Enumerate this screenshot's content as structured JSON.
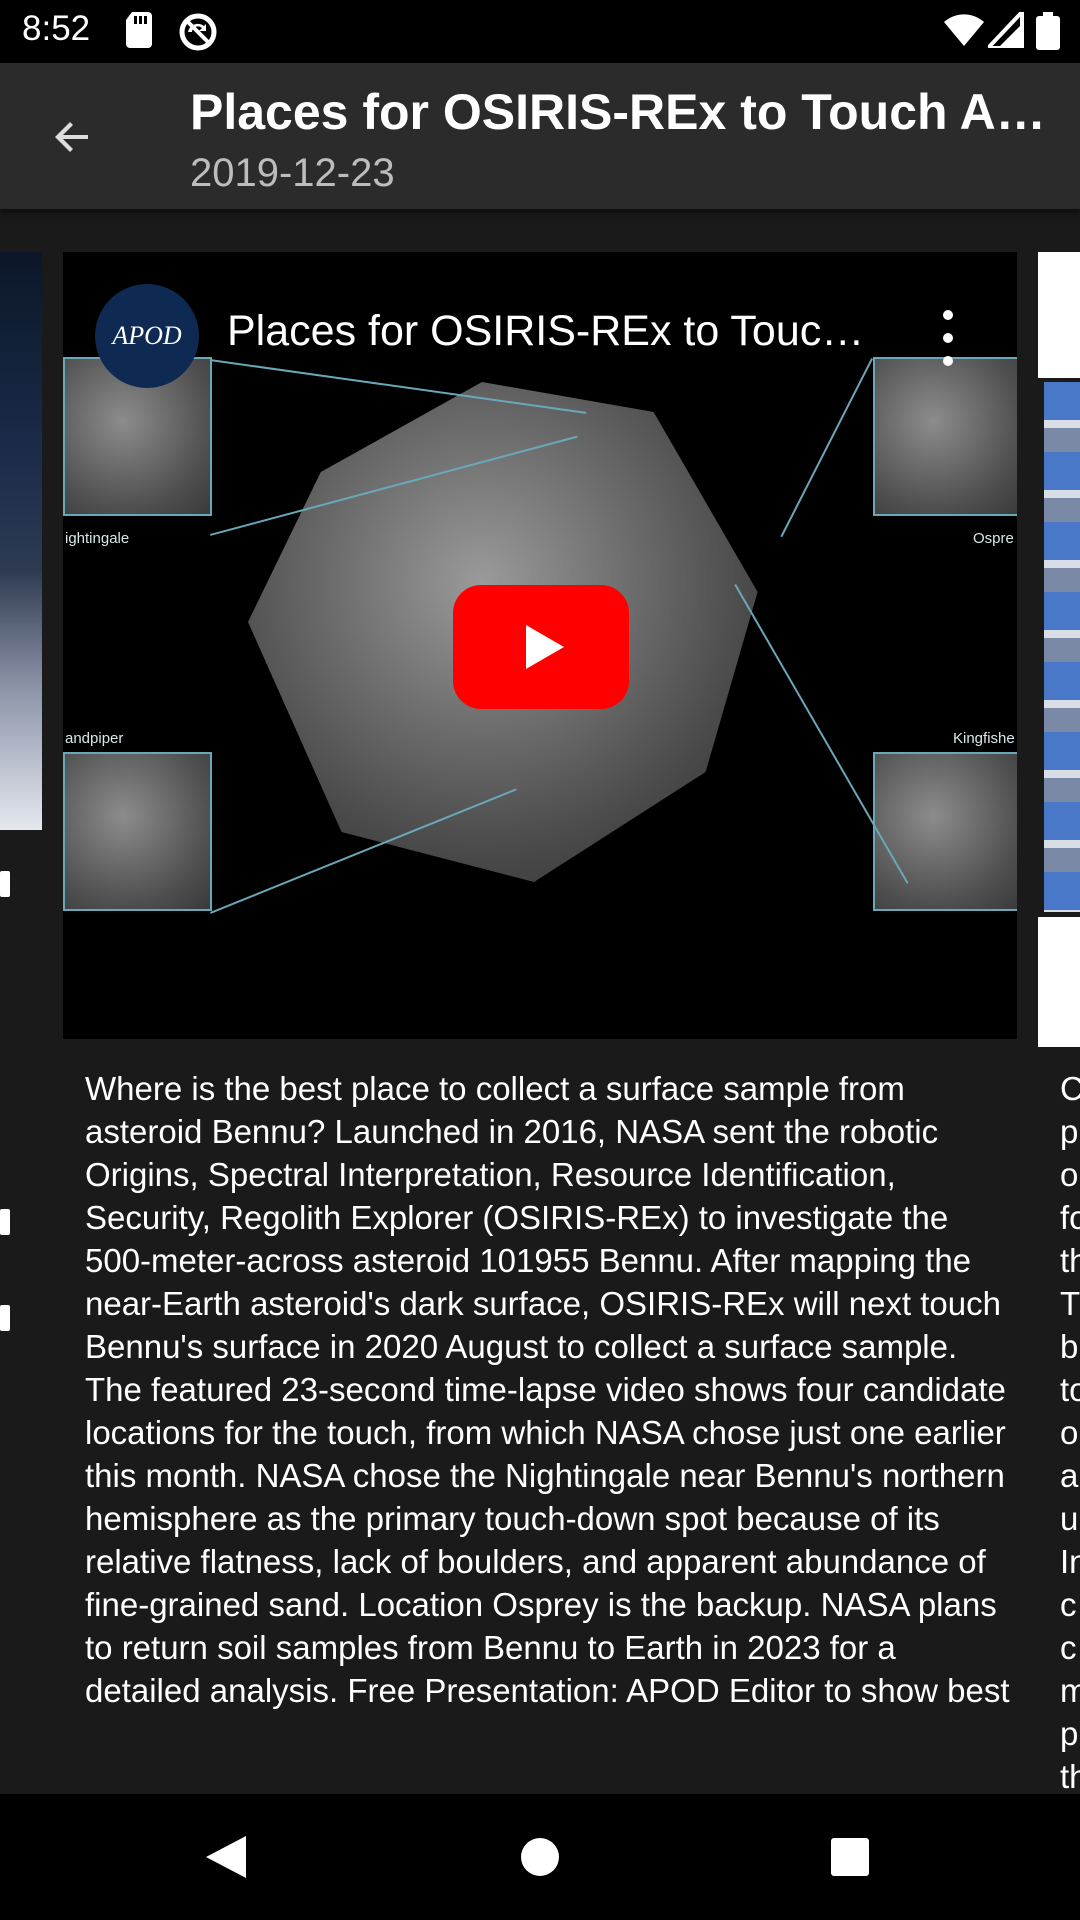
{
  "status_bar": {
    "time": "8:52",
    "icons": [
      "sd-card-icon",
      "no-sync-icon",
      "wifi-icon",
      "signal-icon",
      "battery-icon"
    ]
  },
  "app_bar": {
    "title": "Places for OSIRIS-REx to Touch A…",
    "date": "2019-12-23",
    "back_icon": "arrow-back-icon"
  },
  "video": {
    "title": "Places for OSIRIS-REx to Touc…",
    "channel_logo": "APOD",
    "labels": {
      "nightingale": "ightingale",
      "osprey": "Ospre",
      "sandpiper": "andpiper",
      "kingfisher": "Kingfishe"
    },
    "play_icon": "youtube-play-icon",
    "menu_icon": "more-vert-icon"
  },
  "description": "Where is the best place to collect a surface sample from asteroid Bennu?  Launched in 2016, NASA sent the robotic Origins, Spectral Interpretation, Resource Identification, Security, Regolith Explorer (OSIRIS-REx) to investigate the 500-meter-across asteroid 101955 Bennu. After mapping the near-Earth asteroid's dark surface, OSIRIS-REx will next touch Bennu's surface in 2020 August to collect a surface sample.  The featured 23-second time-lapse video shows four candidate locations for the touch, from which NASA chose just one earlier this month. NASA chose the Nightingale near Bennu's northern hemisphere as the primary touch-down spot because of its relative flatness, lack of boulders, and apparent abundance of fine-grained sand. Location Osprey is the backup.  NASA plans to return soil samples from Bennu to Earth in 2023 for a detailed analysis.    Free Presentation: APOD Editor to show best",
  "right_peek_letters": [
    "C",
    "p",
    "o",
    "fo",
    "th",
    "T",
    "b",
    "to",
    "o",
    "a",
    "u",
    "In",
    "c",
    "c",
    "m",
    "p",
    "th"
  ],
  "nav_bar": {
    "back": "nav-back-icon",
    "home": "nav-home-icon",
    "recents": "nav-recents-icon"
  }
}
